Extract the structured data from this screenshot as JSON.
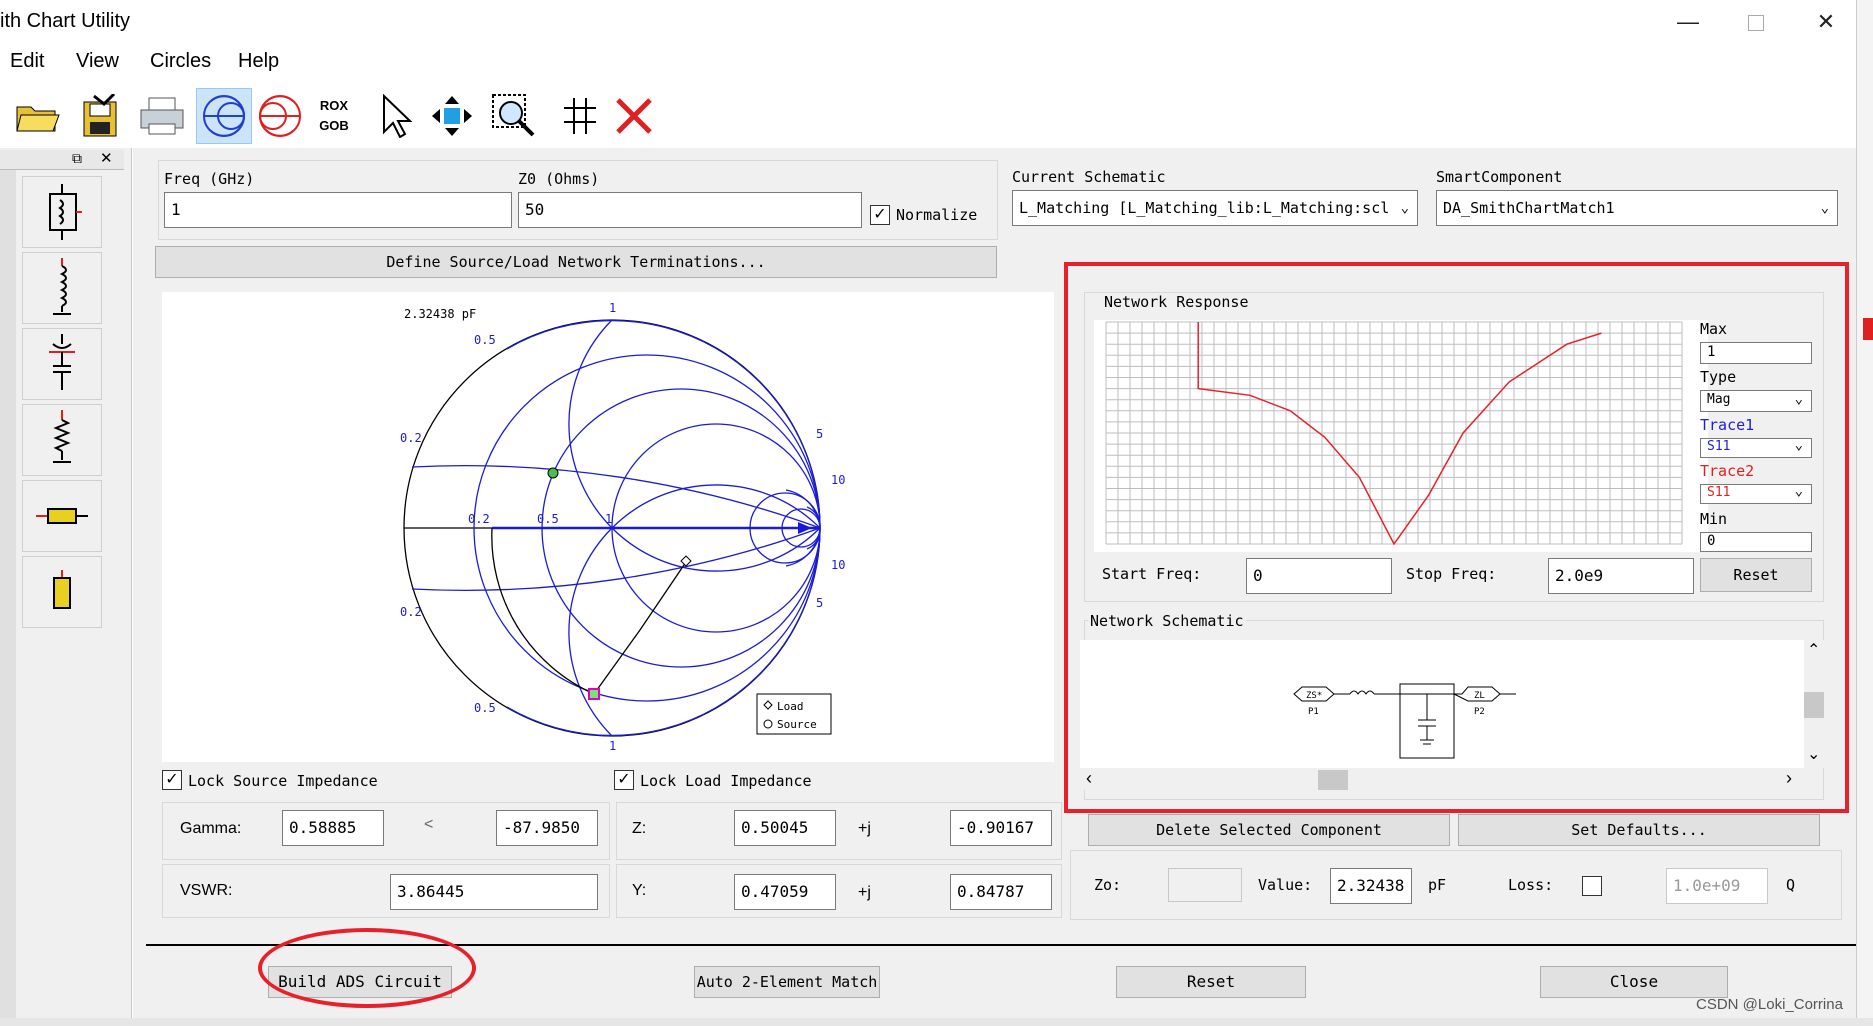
{
  "window": {
    "title": "ith Chart Utility",
    "min_icon": "minimize-icon",
    "max_icon": "maximize-icon",
    "close_icon": "close-icon"
  },
  "menu": [
    "Edit",
    "View",
    "Circles",
    "Help"
  ],
  "toolbar": {
    "icons": [
      "open-folder-icon",
      "save-disk-icon",
      "print-icon",
      "smith-chart-z-icon",
      "smith-chart-y-icon",
      "rox-gob-icon",
      "pointer-icon",
      "move-icon",
      "zoom-icon",
      "split-icon",
      "delete-icon"
    ],
    "rox_label": "ROX",
    "gob_label": "GOB"
  },
  "palette": {
    "items": [
      "transformer-icon",
      "series-inductor-icon",
      "shunt-capacitor-icon",
      "shunt-resistor-icon",
      "series-resistor-icon",
      "open-stub-icon"
    ]
  },
  "freq": {
    "label": "Freq (GHz)",
    "value": "1"
  },
  "z0": {
    "label": "Z0 (Ohms)",
    "value": "50"
  },
  "normalize": {
    "label": "Normalize",
    "checked": true
  },
  "current_schematic": {
    "label": "Current Schematic",
    "value": "L_Matching [L_Matching_lib:L_Matching:scl"
  },
  "smart_component": {
    "label": "SmartComponent",
    "value": "DA_SmithChartMatch1"
  },
  "define_button": "Define Source/Load Network Terminations...",
  "smith": {
    "component_label": "2.32438 pF",
    "scale_labels": [
      "1",
      "0.5",
      "0.2",
      "0.2",
      "0.5",
      "1",
      "5",
      "10",
      "10",
      "5",
      "0.2",
      "0.5",
      "1"
    ],
    "legend": [
      "Load",
      "Source"
    ]
  },
  "lock_source": {
    "label": "Lock Source Impedance",
    "checked": true
  },
  "lock_load": {
    "label": "Lock Load Impedance",
    "checked": true
  },
  "gamma": {
    "label": "Gamma:",
    "mag": "0.58885",
    "angle_symbol": "<",
    "angle": "-87.9850"
  },
  "vswr": {
    "label": "VSWR:",
    "value": "3.86445"
  },
  "z": {
    "label": "Z:",
    "real": "0.50045",
    "j_label": "+j",
    "imag": "-0.90167"
  },
  "y": {
    "label": "Y:",
    "real": "0.47059",
    "j_label": "+j",
    "imag": "0.84787"
  },
  "network_response": {
    "title": "Network Response",
    "max_label": "Max",
    "max_value": "1",
    "type_label": "Type",
    "type_value": "Mag",
    "trace1_label": "Trace1",
    "trace1_value": "S11",
    "trace2_label": "Trace2",
    "trace2_value": "S11",
    "min_label": "Min",
    "min_value": "0",
    "start_label": "Start Freq:",
    "start_value": "0",
    "stop_label": "Stop Freq:",
    "stop_value": "2.0e9",
    "reset_label": "Reset",
    "trace_color": "#e8202a",
    "trace1_color": "#2020d0"
  },
  "network_schematic": {
    "title": "Network Schematic",
    "zs_label": "ZS*",
    "p1_label": "P1",
    "zl_label": "ZL",
    "p2_label": "P2"
  },
  "delete_selected": "Delete Selected Component",
  "set_defaults": "Set Defaults...",
  "component_edit": {
    "zo_label": "Zo:",
    "value_label": "Value:",
    "value": "2.32438",
    "unit": "pF",
    "loss_label": "Loss:",
    "q_value": "1.0e+09",
    "q_label": "Q"
  },
  "bottom": {
    "build": "Build ADS Circuit",
    "auto": "Auto 2-Element Match",
    "reset": "Reset",
    "close": "Close"
  },
  "watermark": "CSDN @Loki_Corrina",
  "annotation_color": "#e8202a"
}
